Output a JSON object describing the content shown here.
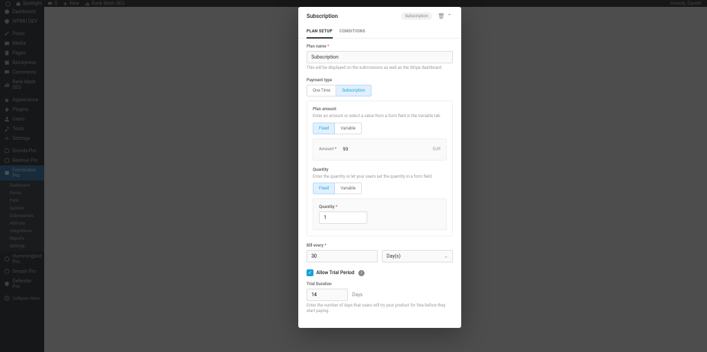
{
  "adminbar": {
    "site": "Spotlight",
    "comments": "0",
    "new": "New",
    "seo": "Rank Math SEO",
    "howdy": "Howdy, Gareth"
  },
  "sidebar": {
    "items": [
      {
        "label": "Dashboard"
      },
      {
        "label": "WPMU DEV"
      },
      {
        "label": "Posts"
      },
      {
        "label": "Media"
      },
      {
        "label": "Pages"
      },
      {
        "label": "Blockpress"
      },
      {
        "label": "Comments"
      },
      {
        "label": "Rank Math SEO"
      },
      {
        "label": "Appearance"
      },
      {
        "label": "Plugins"
      },
      {
        "label": "Users"
      },
      {
        "label": "Tools"
      },
      {
        "label": "Settings"
      },
      {
        "label": "Branda Pro"
      },
      {
        "label": "Beehive Pro"
      },
      {
        "label": "Forminator Pro"
      },
      {
        "label": "Hummingbird Pro"
      },
      {
        "label": "Smush Pro"
      },
      {
        "label": "Defender Pro"
      }
    ],
    "submenu": [
      "Dashboard",
      "Forms",
      "Polls",
      "Quizzes",
      "Submissions",
      "Add-ons",
      "Integrations",
      "Reports",
      "Settings"
    ],
    "collapse": "Collapse menu"
  },
  "modal": {
    "title": "Subscription",
    "badge": "Subscription",
    "tabs": {
      "plan": "PLAN SETUP",
      "conditions": "CONDITIONS"
    },
    "plan_name_label": "Plan name",
    "plan_name_value": "Subscription",
    "plan_name_help": "This will be displayed on the submissions as well as the Stripe dashboard.",
    "payment_type_label": "Payment type",
    "payment_type": {
      "one_time": "One Time",
      "subscription": "Subscription"
    },
    "plan_amount": {
      "title": "Plan amount",
      "help": "Enter an amount or select a value from a form field in the Variable tab.",
      "fixed": "Fixed",
      "variable": "Variable",
      "amount_label": "Amount",
      "amount_value": "99",
      "currency": "EUR"
    },
    "quantity": {
      "title": "Quantity",
      "help": "Enter the quantity or let your users set the quantity in a form field.",
      "fixed": "Fixed",
      "variable": "Variable",
      "label": "Quantity",
      "value": "1"
    },
    "bill": {
      "label": "Bill every",
      "value": "30",
      "unit": "Day(s)"
    },
    "trial": {
      "allow": "Allow Trial Period",
      "duration_label": "Trial Duration",
      "value": "14",
      "unit": "Days",
      "help": "Enter the number of days that users will try your product for free before they start paying."
    }
  }
}
